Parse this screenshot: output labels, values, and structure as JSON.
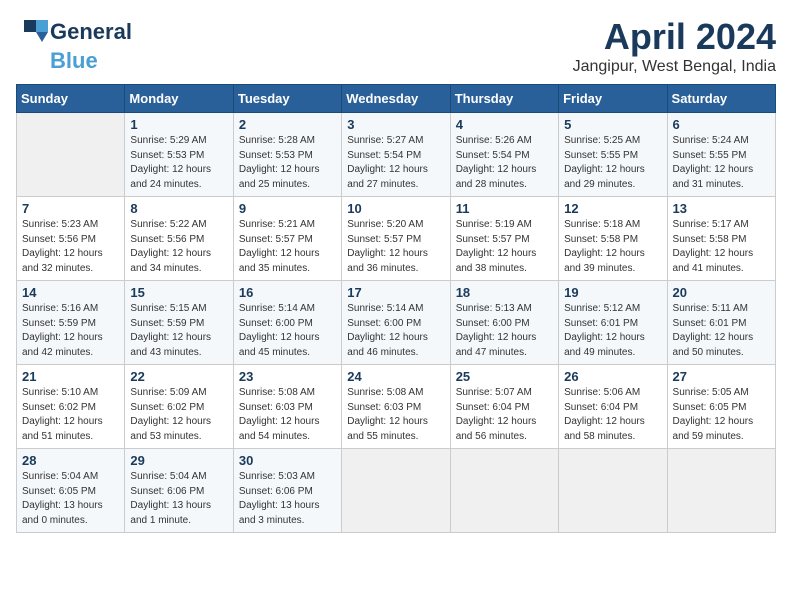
{
  "header": {
    "logo_general": "General",
    "logo_blue": "Blue",
    "month_title": "April 2024",
    "location": "Jangipur, West Bengal, India"
  },
  "weekdays": [
    "Sunday",
    "Monday",
    "Tuesday",
    "Wednesday",
    "Thursday",
    "Friday",
    "Saturday"
  ],
  "weeks": [
    [
      {
        "day": "",
        "sunrise": "",
        "sunset": "",
        "daylight": ""
      },
      {
        "day": "1",
        "sunrise": "Sunrise: 5:29 AM",
        "sunset": "Sunset: 5:53 PM",
        "daylight": "Daylight: 12 hours and 24 minutes."
      },
      {
        "day": "2",
        "sunrise": "Sunrise: 5:28 AM",
        "sunset": "Sunset: 5:53 PM",
        "daylight": "Daylight: 12 hours and 25 minutes."
      },
      {
        "day": "3",
        "sunrise": "Sunrise: 5:27 AM",
        "sunset": "Sunset: 5:54 PM",
        "daylight": "Daylight: 12 hours and 27 minutes."
      },
      {
        "day": "4",
        "sunrise": "Sunrise: 5:26 AM",
        "sunset": "Sunset: 5:54 PM",
        "daylight": "Daylight: 12 hours and 28 minutes."
      },
      {
        "day": "5",
        "sunrise": "Sunrise: 5:25 AM",
        "sunset": "Sunset: 5:55 PM",
        "daylight": "Daylight: 12 hours and 29 minutes."
      },
      {
        "day": "6",
        "sunrise": "Sunrise: 5:24 AM",
        "sunset": "Sunset: 5:55 PM",
        "daylight": "Daylight: 12 hours and 31 minutes."
      }
    ],
    [
      {
        "day": "7",
        "sunrise": "Sunrise: 5:23 AM",
        "sunset": "Sunset: 5:56 PM",
        "daylight": "Daylight: 12 hours and 32 minutes."
      },
      {
        "day": "8",
        "sunrise": "Sunrise: 5:22 AM",
        "sunset": "Sunset: 5:56 PM",
        "daylight": "Daylight: 12 hours and 34 minutes."
      },
      {
        "day": "9",
        "sunrise": "Sunrise: 5:21 AM",
        "sunset": "Sunset: 5:57 PM",
        "daylight": "Daylight: 12 hours and 35 minutes."
      },
      {
        "day": "10",
        "sunrise": "Sunrise: 5:20 AM",
        "sunset": "Sunset: 5:57 PM",
        "daylight": "Daylight: 12 hours and 36 minutes."
      },
      {
        "day": "11",
        "sunrise": "Sunrise: 5:19 AM",
        "sunset": "Sunset: 5:57 PM",
        "daylight": "Daylight: 12 hours and 38 minutes."
      },
      {
        "day": "12",
        "sunrise": "Sunrise: 5:18 AM",
        "sunset": "Sunset: 5:58 PM",
        "daylight": "Daylight: 12 hours and 39 minutes."
      },
      {
        "day": "13",
        "sunrise": "Sunrise: 5:17 AM",
        "sunset": "Sunset: 5:58 PM",
        "daylight": "Daylight: 12 hours and 41 minutes."
      }
    ],
    [
      {
        "day": "14",
        "sunrise": "Sunrise: 5:16 AM",
        "sunset": "Sunset: 5:59 PM",
        "daylight": "Daylight: 12 hours and 42 minutes."
      },
      {
        "day": "15",
        "sunrise": "Sunrise: 5:15 AM",
        "sunset": "Sunset: 5:59 PM",
        "daylight": "Daylight: 12 hours and 43 minutes."
      },
      {
        "day": "16",
        "sunrise": "Sunrise: 5:14 AM",
        "sunset": "Sunset: 6:00 PM",
        "daylight": "Daylight: 12 hours and 45 minutes."
      },
      {
        "day": "17",
        "sunrise": "Sunrise: 5:14 AM",
        "sunset": "Sunset: 6:00 PM",
        "daylight": "Daylight: 12 hours and 46 minutes."
      },
      {
        "day": "18",
        "sunrise": "Sunrise: 5:13 AM",
        "sunset": "Sunset: 6:00 PM",
        "daylight": "Daylight: 12 hours and 47 minutes."
      },
      {
        "day": "19",
        "sunrise": "Sunrise: 5:12 AM",
        "sunset": "Sunset: 6:01 PM",
        "daylight": "Daylight: 12 hours and 49 minutes."
      },
      {
        "day": "20",
        "sunrise": "Sunrise: 5:11 AM",
        "sunset": "Sunset: 6:01 PM",
        "daylight": "Daylight: 12 hours and 50 minutes."
      }
    ],
    [
      {
        "day": "21",
        "sunrise": "Sunrise: 5:10 AM",
        "sunset": "Sunset: 6:02 PM",
        "daylight": "Daylight: 12 hours and 51 minutes."
      },
      {
        "day": "22",
        "sunrise": "Sunrise: 5:09 AM",
        "sunset": "Sunset: 6:02 PM",
        "daylight": "Daylight: 12 hours and 53 minutes."
      },
      {
        "day": "23",
        "sunrise": "Sunrise: 5:08 AM",
        "sunset": "Sunset: 6:03 PM",
        "daylight": "Daylight: 12 hours and 54 minutes."
      },
      {
        "day": "24",
        "sunrise": "Sunrise: 5:08 AM",
        "sunset": "Sunset: 6:03 PM",
        "daylight": "Daylight: 12 hours and 55 minutes."
      },
      {
        "day": "25",
        "sunrise": "Sunrise: 5:07 AM",
        "sunset": "Sunset: 6:04 PM",
        "daylight": "Daylight: 12 hours and 56 minutes."
      },
      {
        "day": "26",
        "sunrise": "Sunrise: 5:06 AM",
        "sunset": "Sunset: 6:04 PM",
        "daylight": "Daylight: 12 hours and 58 minutes."
      },
      {
        "day": "27",
        "sunrise": "Sunrise: 5:05 AM",
        "sunset": "Sunset: 6:05 PM",
        "daylight": "Daylight: 12 hours and 59 minutes."
      }
    ],
    [
      {
        "day": "28",
        "sunrise": "Sunrise: 5:04 AM",
        "sunset": "Sunset: 6:05 PM",
        "daylight": "Daylight: 13 hours and 0 minutes."
      },
      {
        "day": "29",
        "sunrise": "Sunrise: 5:04 AM",
        "sunset": "Sunset: 6:06 PM",
        "daylight": "Daylight: 13 hours and 1 minute."
      },
      {
        "day": "30",
        "sunrise": "Sunrise: 5:03 AM",
        "sunset": "Sunset: 6:06 PM",
        "daylight": "Daylight: 13 hours and 3 minutes."
      },
      {
        "day": "",
        "sunrise": "",
        "sunset": "",
        "daylight": ""
      },
      {
        "day": "",
        "sunrise": "",
        "sunset": "",
        "daylight": ""
      },
      {
        "day": "",
        "sunrise": "",
        "sunset": "",
        "daylight": ""
      },
      {
        "day": "",
        "sunrise": "",
        "sunset": "",
        "daylight": ""
      }
    ]
  ]
}
